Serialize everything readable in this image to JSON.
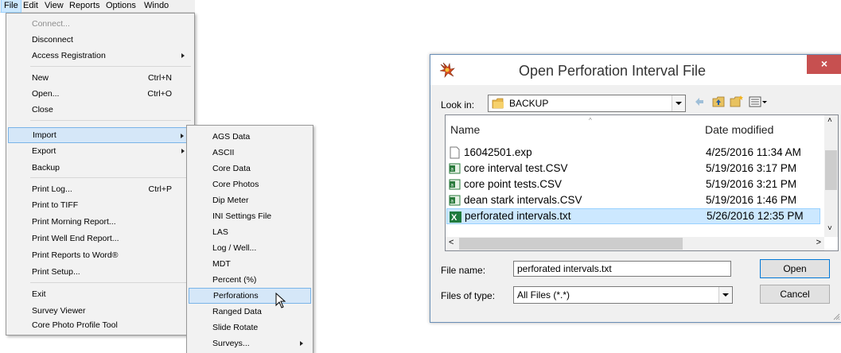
{
  "menubar": {
    "items": [
      "File",
      "Edit",
      "View",
      "Reports",
      "Options",
      "Windo"
    ]
  },
  "file_menu": {
    "items": [
      {
        "label": "Connect...",
        "disabled": true
      },
      {
        "label": "Disconnect"
      },
      {
        "label": "Access Registration",
        "submenu": true
      },
      {
        "label": "New",
        "shortcut": "Ctrl+N"
      },
      {
        "label": "Open...",
        "shortcut": "Ctrl+O"
      },
      {
        "label": "Close"
      },
      {
        "label": "Import",
        "submenu": true,
        "highlighted": true
      },
      {
        "label": "Export",
        "submenu": true
      },
      {
        "label": "Backup"
      },
      {
        "label": "Print Log...",
        "shortcut": "Ctrl+P"
      },
      {
        "label": "Print to TIFF"
      },
      {
        "label": "Print Morning Report..."
      },
      {
        "label": "Print Well End Report..."
      },
      {
        "label": "Print Reports to Word®"
      },
      {
        "label": "Print Setup..."
      },
      {
        "label": "Exit"
      },
      {
        "label": "Survey Viewer"
      },
      {
        "label": "Core Photo Profile Tool"
      }
    ]
  },
  "import_submenu": {
    "items": [
      {
        "label": "AGS Data"
      },
      {
        "label": "ASCII"
      },
      {
        "label": "Core Data"
      },
      {
        "label": "Core Photos"
      },
      {
        "label": "Dip Meter"
      },
      {
        "label": "INI Settings File"
      },
      {
        "label": "LAS"
      },
      {
        "label": "Log / Well..."
      },
      {
        "label": "MDT"
      },
      {
        "label": "Percent (%)"
      },
      {
        "label": "Perforations",
        "highlighted": true
      },
      {
        "label": "Ranged Data"
      },
      {
        "label": "Slide Rotate"
      },
      {
        "label": "Surveys...",
        "submenu": true
      }
    ]
  },
  "dialog": {
    "title": "Open Perforation Interval File",
    "close_label": "×",
    "look_in_label": "Look in:",
    "look_in_value": "BACKUP",
    "columns": {
      "name": "Name",
      "date": "Date modified"
    },
    "files": [
      {
        "name": "16042501.exp",
        "date": "4/25/2016 11:34 AM",
        "icon": "blank-file-icon"
      },
      {
        "name": "core interval test.CSV",
        "date": "5/19/2016 3:17 PM",
        "icon": "csv-file-icon"
      },
      {
        "name": "core point tests.CSV",
        "date": "5/19/2016 3:21 PM",
        "icon": "csv-file-icon"
      },
      {
        "name": "dean stark intervals.CSV",
        "date": "5/19/2016 1:46 PM",
        "icon": "csv-file-icon"
      },
      {
        "name": "perforated intervals.txt",
        "date": "5/26/2016 12:35 PM",
        "icon": "excel-file-icon",
        "selected": true
      }
    ],
    "file_name_label": "File name:",
    "file_name_value": "perforated intervals.txt",
    "files_of_type_label": "Files of type:",
    "files_of_type_value": "All Files (*.*)",
    "open_label": "Open",
    "cancel_label": "Cancel"
  }
}
